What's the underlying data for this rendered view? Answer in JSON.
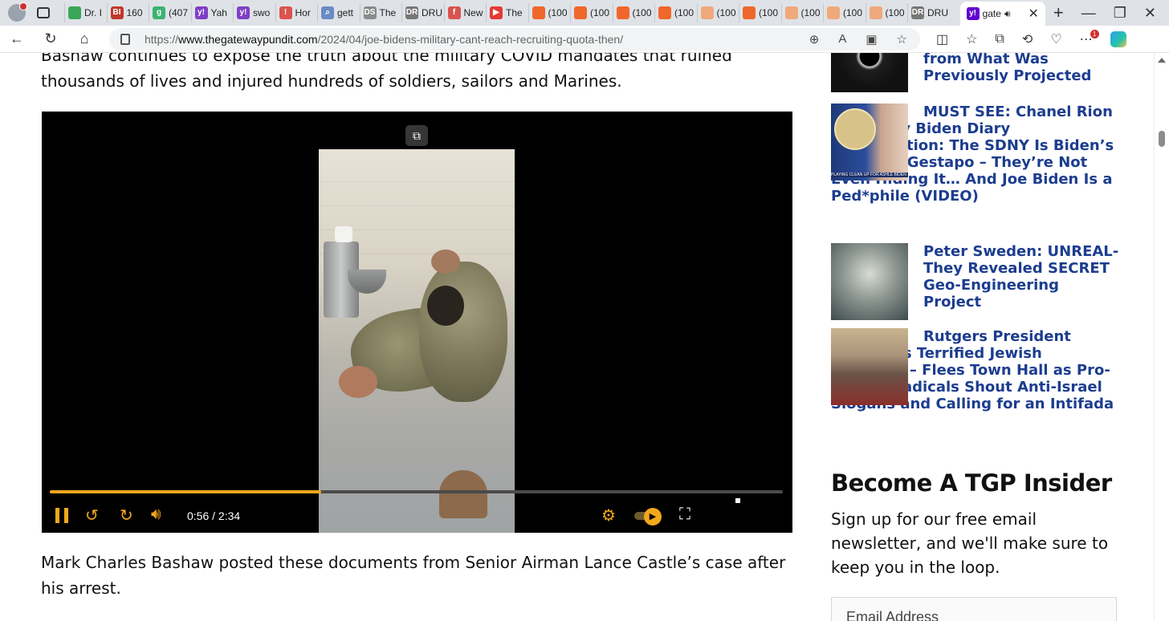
{
  "browser": {
    "tabs": [
      {
        "label": "Dr. I",
        "icon": "play-icon",
        "color": "#3aa757"
      },
      {
        "label": "160",
        "icon": "bi-icon",
        "color": "#c0392b",
        "glyph": "BI"
      },
      {
        "label": "(407",
        "icon": "g-icon",
        "color": "#3cb371",
        "glyph": "g"
      },
      {
        "label": "Yah",
        "icon": "yahoo-icon",
        "color": "#7e3fc4",
        "glyph": "y!"
      },
      {
        "label": "swo",
        "icon": "yahoo-icon",
        "color": "#7e3fc4",
        "glyph": "y!"
      },
      {
        "label": "Hor",
        "icon": "red-icon",
        "color": "#d9534f",
        "glyph": "!"
      },
      {
        "label": "gett",
        "icon": "search-icon",
        "color": "#6b8bc3",
        "glyph": "⌕"
      },
      {
        "label": "The",
        "icon": "ds-icon",
        "color": "#8a8a8a",
        "glyph": "DS"
      },
      {
        "label": "DRU",
        "icon": "dr-icon",
        "color": "#777777",
        "glyph": "DR"
      },
      {
        "label": "New",
        "icon": "f-icon",
        "color": "#d9534f",
        "glyph": "f"
      },
      {
        "label": "The",
        "icon": "youtube-icon",
        "color": "#e53935",
        "glyph": "▶"
      },
      {
        "label": "(100",
        "icon": "bookmark-icon",
        "color": "#f0672b",
        "glyph": ""
      },
      {
        "label": "(100",
        "icon": "bookmark-icon",
        "color": "#f0672b",
        "glyph": ""
      },
      {
        "label": "(100",
        "icon": "bookmark-icon",
        "color": "#f0672b",
        "glyph": ""
      },
      {
        "label": "(100",
        "icon": "bookmark-icon",
        "color": "#f0672b",
        "glyph": ""
      },
      {
        "label": "(100",
        "icon": "bookmark-icon",
        "color": "#f0a97b",
        "glyph": ""
      },
      {
        "label": "(100",
        "icon": "bookmark-icon",
        "color": "#f0672b",
        "glyph": ""
      },
      {
        "label": "(100",
        "icon": "bookmark-icon",
        "color": "#f0a97b",
        "glyph": ""
      },
      {
        "label": "(100",
        "icon": "bookmark-icon",
        "color": "#f0a97b",
        "glyph": ""
      },
      {
        "label": "(100",
        "icon": "bookmark-icon",
        "color": "#f0a97b",
        "glyph": ""
      },
      {
        "label": "DRU",
        "icon": "dr-icon",
        "color": "#777777",
        "glyph": "DR"
      }
    ],
    "active_tab": {
      "label": "gate",
      "icon": "yahoo-icon",
      "color": "#6001d2",
      "glyph": "y!"
    },
    "url_prefix": "https://",
    "url_domain": "www.thegatewaypundit.com",
    "url_path": "/2024/04/joe-bidens-military-cant-reach-recruiting-quota-then/",
    "notification_count": "1"
  },
  "article": {
    "intro": "Bashaw continues to expose the truth about the military COVID mandates that ruined thousands of lives and injured hundreds of soldiers, sailors and Marines.",
    "after_video": "Mark Charles Bashaw posted these documents from Senior Airman Lance Castle’s case after his arrest."
  },
  "video": {
    "time": "0:56 / 2:34",
    "progress": 0.37,
    "accent": "#f2a81d"
  },
  "sidebar": {
    "stories": [
      {
        "title": "from What Was Previously Projected"
      },
      {
        "title": "MUST SEE: Chanel Rion on Ashley Biden Diary Investigation: The SDNY Is Biden’s Personal Gestapo – They’re Not Even Hiding It… And Joe Biden Is a Ped*phile (VIDEO)",
        "thumb_caption": "PLAYING CLEAN UP FOR ASHLE BIDEN - YOU"
      },
      {
        "title": "Peter Sweden: UNREAL- They Revealed SECRET Geo-Engineering Project"
      },
      {
        "title": "Rutgers President Abandons Terrified Jewish Students – Flees Town Hall as Pro-Hamas Radicals Shout Anti-Israel Slogans and Calling for an Intifada"
      }
    ],
    "insider_title": "Become A TGP Insider",
    "insider_text": "Sign up for our free email newsletter, and we'll make sure to keep you in the loop.",
    "email_placeholder": "Email Address"
  }
}
